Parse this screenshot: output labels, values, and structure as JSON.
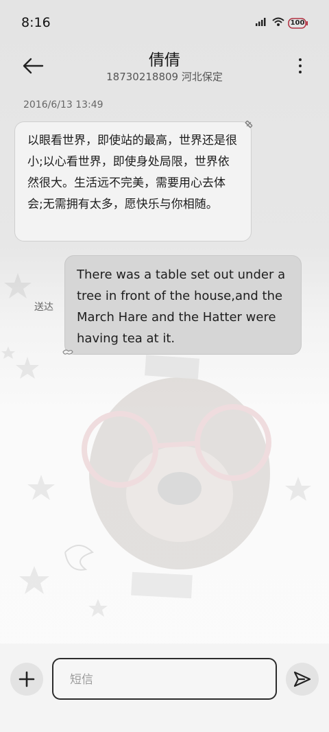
{
  "status_bar": {
    "time": "8:16",
    "icons": [
      "signal-icon",
      "wifi-icon",
      "battery-icon"
    ],
    "battery_level": "100"
  },
  "header": {
    "contact_name": "倩倩",
    "contact_detail": "18730218809 河北保定"
  },
  "conversation": {
    "timestamp": "2016/6/13 13:49",
    "incoming_message": "以眼看世界，即使站的最高，世界还是很小;以心看世界，即使身处局限，世界依然很大。生活远不完美，需要用心去体会;无需拥有太多，愿快乐与你相随。",
    "outgoing_message": "There was a table set out under a tree in front of the house,and the March Hare and the Hatter were having tea at it.",
    "outgoing_status": "送达"
  },
  "composer": {
    "placeholder": "短信",
    "value": ""
  },
  "colors": {
    "incoming_bubble": "#f3f3f3",
    "outgoing_bubble": "#d6d6d6",
    "text": "#1c1c1c"
  }
}
